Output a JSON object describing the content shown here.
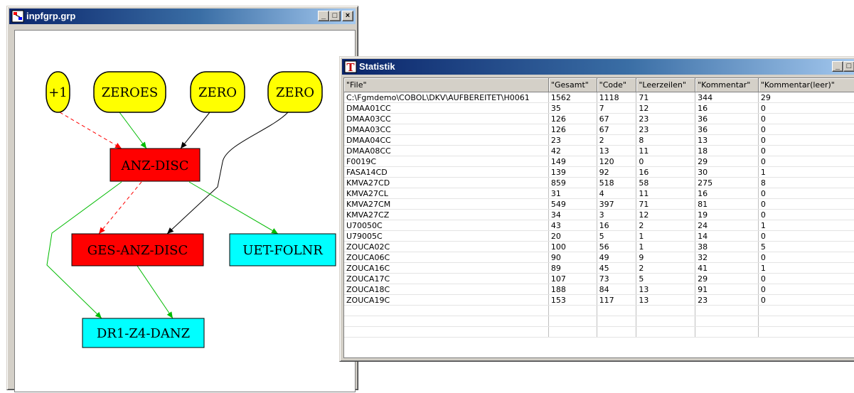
{
  "graph_window": {
    "title": "inpfgrp.grp",
    "controls": {
      "minimize": "_",
      "maximize": "□",
      "close": "×"
    },
    "nodes": [
      {
        "id": "n1",
        "label": "+1",
        "fill": "#ffff00"
      },
      {
        "id": "n2",
        "label": "ZEROES",
        "fill": "#ffff00"
      },
      {
        "id": "n3",
        "label": "ZERO",
        "fill": "#ffff00"
      },
      {
        "id": "n4",
        "label": "ZERO",
        "fill": "#ffff00"
      },
      {
        "id": "n5",
        "label": "ANZ-DISC",
        "fill": "#ff0000"
      },
      {
        "id": "n6",
        "label": "GES-ANZ-DISC",
        "fill": "#ff0000"
      },
      {
        "id": "n7",
        "label": "UET-FOLNR",
        "fill": "#00ffff"
      },
      {
        "id": "n8",
        "label": "DR1-Z4-DANZ",
        "fill": "#00ffff"
      }
    ],
    "edge_colors": {
      "red": "#ff0000",
      "green": "#00bb00",
      "black": "#000000"
    }
  },
  "stat_window": {
    "title": "Statistik",
    "controls": {
      "minimize": "_",
      "maximize": "□",
      "close": "×"
    },
    "columns": [
      "\"File\"",
      "\"Gesamt\"",
      "\"Code\"",
      "\"Leerzeilen\"",
      "\"Kommentar\"",
      "\"Kommentar(leer)\""
    ],
    "rows": [
      [
        "C:\\Fgmdemo\\COBOL\\DKV\\AUFBEREITET\\H0061",
        "1562",
        "1118",
        "71",
        "344",
        "29"
      ],
      [
        "DMAA01CC",
        "35",
        "7",
        "12",
        "16",
        "0"
      ],
      [
        "DMAA03CC",
        "126",
        "67",
        "23",
        "36",
        "0"
      ],
      [
        "DMAA03CC",
        "126",
        "67",
        "23",
        "36",
        "0"
      ],
      [
        "DMAA04CC",
        "23",
        "2",
        "8",
        "13",
        "0"
      ],
      [
        "DMAA08CC",
        "42",
        "13",
        "11",
        "18",
        "0"
      ],
      [
        "F0019C",
        "149",
        "120",
        "0",
        "29",
        "0"
      ],
      [
        "FASA14CD",
        "139",
        "92",
        "16",
        "30",
        "1"
      ],
      [
        "KMVA27CD",
        "859",
        "518",
        "58",
        "275",
        "8"
      ],
      [
        "KMVA27CL",
        "31",
        "4",
        "11",
        "16",
        "0"
      ],
      [
        "KMVA27CM",
        "549",
        "397",
        "71",
        "81",
        "0"
      ],
      [
        "KMVA27CZ",
        "34",
        "3",
        "12",
        "19",
        "0"
      ],
      [
        "U70050C",
        "43",
        "16",
        "2",
        "24",
        "1"
      ],
      [
        "U79005C",
        "20",
        "5",
        "1",
        "14",
        "0"
      ],
      [
        "ZOUCA02C",
        "100",
        "56",
        "1",
        "38",
        "5"
      ],
      [
        "ZOUCA06C",
        "90",
        "49",
        "9",
        "32",
        "0"
      ],
      [
        "ZOUCA16C",
        "89",
        "45",
        "2",
        "41",
        "1"
      ],
      [
        "ZOUCA17C",
        "107",
        "73",
        "5",
        "29",
        "0"
      ],
      [
        "ZOUCA18C",
        "188",
        "84",
        "13",
        "91",
        "0"
      ],
      [
        "ZOUCA19C",
        "153",
        "117",
        "13",
        "23",
        "0"
      ]
    ],
    "empty_rows": 3
  }
}
